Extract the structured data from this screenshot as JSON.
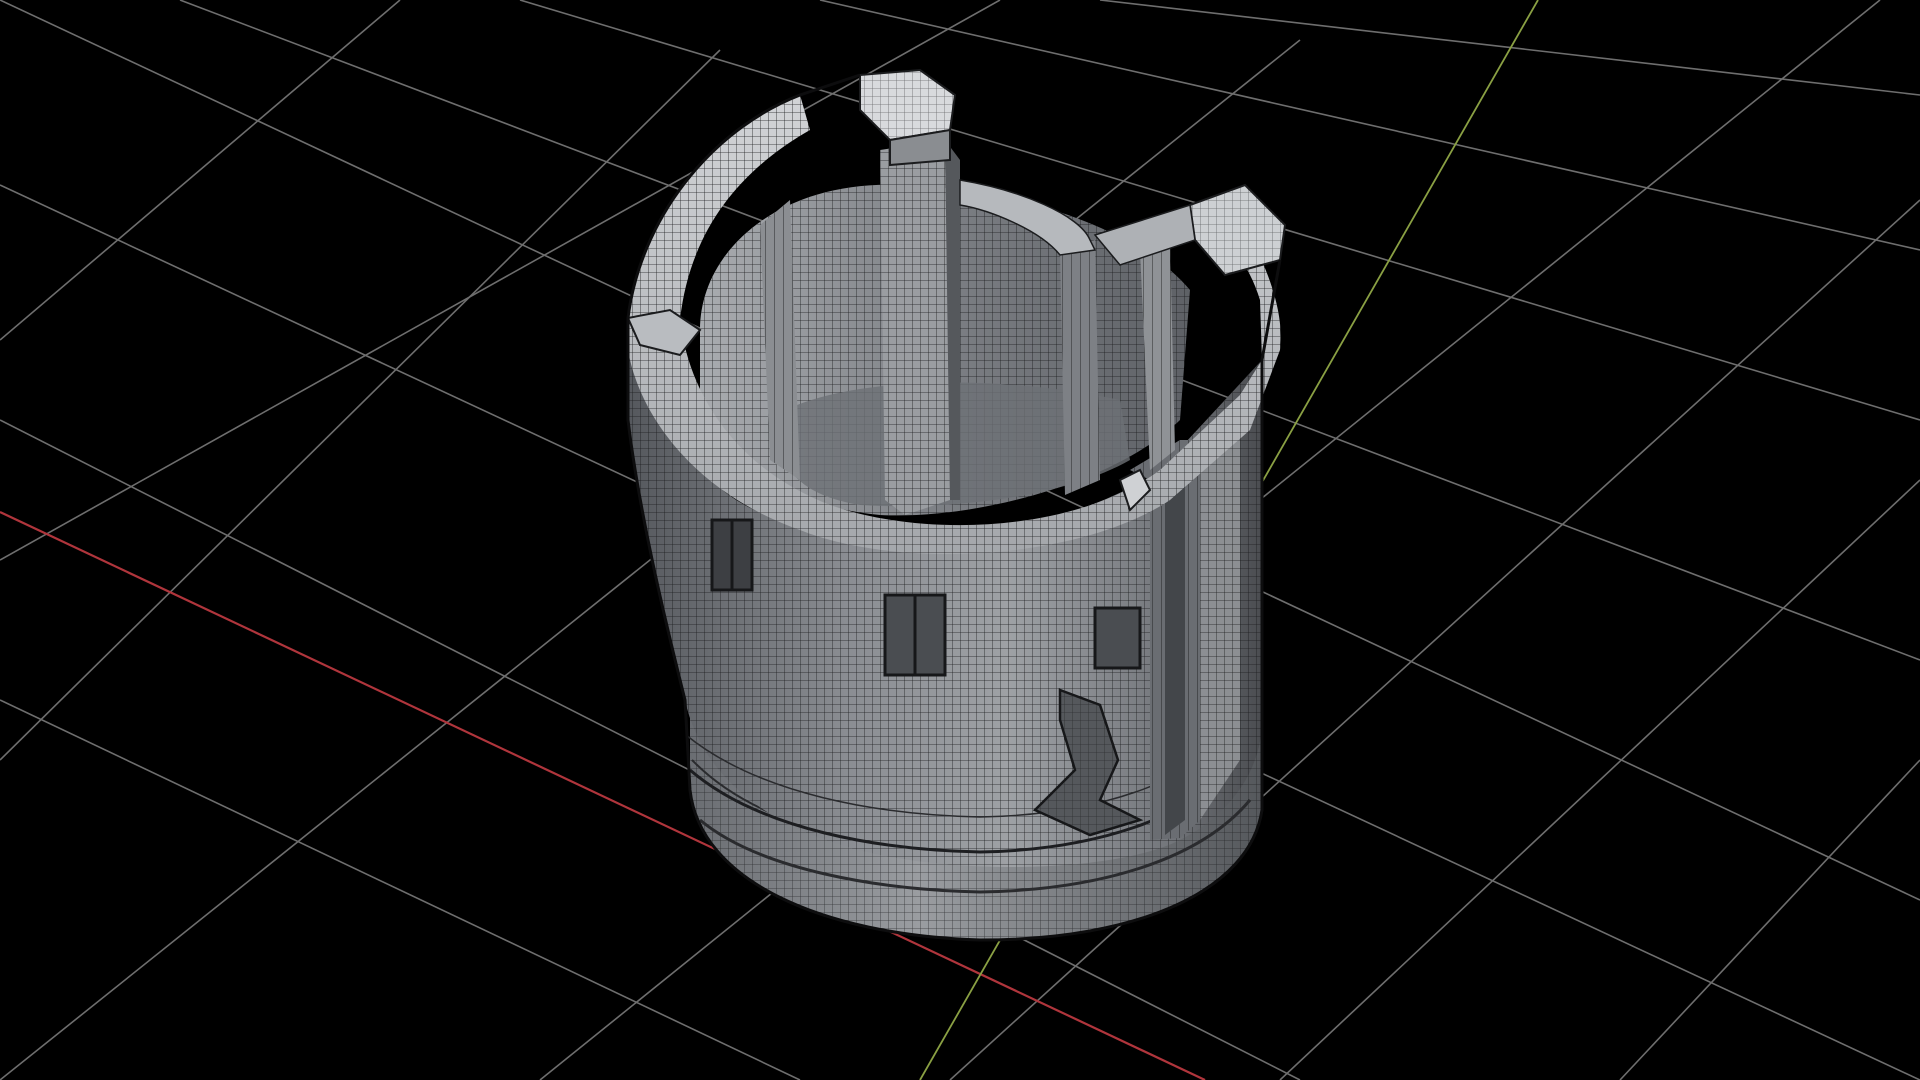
{
  "viewport": {
    "background_color": "#000000",
    "grid": {
      "visible": true,
      "line_color": "#6e6e6e",
      "x_axis_color": "#b0353c",
      "y_axis_color": "#8aa043"
    },
    "model": {
      "display_mode": "shaded-wireframe",
      "surface_color": "#7a7d82",
      "highlight_color": "#c9cbce",
      "shadow_color": "#3a3c40",
      "wire_color": "#1b1c1e"
    }
  }
}
